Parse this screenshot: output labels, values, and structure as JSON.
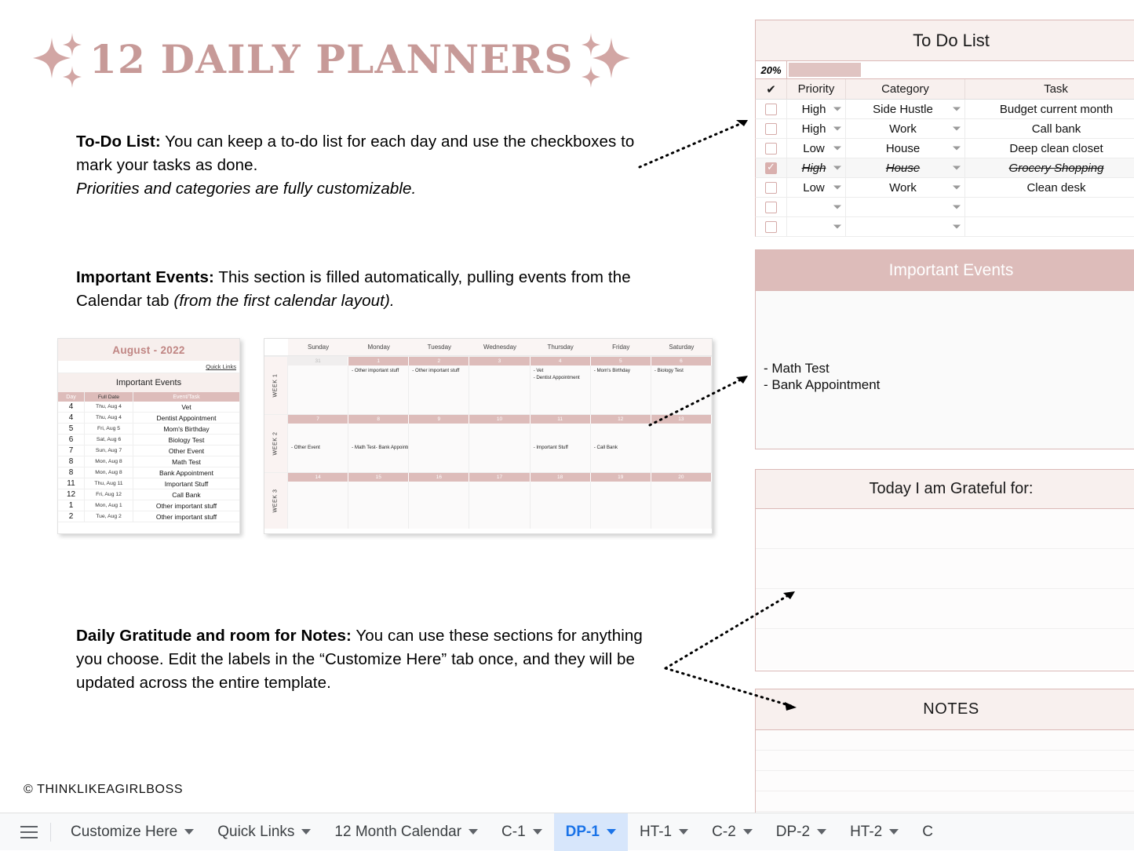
{
  "title": "12 DAILY PLANNERS",
  "paragraphs": {
    "todo": {
      "bold": "To-Do List:",
      "normal": " You can keep a to-do list for each day and use the checkboxes to mark your tasks as done.",
      "italic": "Priorities and categories are fully customizable."
    },
    "events": {
      "bold": "Important Events:",
      "normal": " This section is filled automatically, pulling events from the Calendar tab ",
      "italic": "(from the first calendar layout)."
    },
    "gratitude": {
      "bold": "Daily Gratitude and room for Notes:",
      "normal": " You can use these sections for anything you choose. Edit the labels in the “Customize Here” tab once, and they will be updated across the entire template."
    }
  },
  "mini_month": {
    "month_title": "August - 2022",
    "quick_links": "Quick Links",
    "section_title": "Important Events",
    "columns": [
      "Day",
      "Full Date",
      "Event/Task"
    ],
    "rows": [
      {
        "day": "4",
        "full_date": "Thu, Aug 4",
        "event": "Vet"
      },
      {
        "day": "4",
        "full_date": "Thu, Aug 4",
        "event": "Dentist Appointment"
      },
      {
        "day": "5",
        "full_date": "Fri, Aug 5",
        "event": "Mom's Birthday"
      },
      {
        "day": "6",
        "full_date": "Sat, Aug 6",
        "event": "Biology Test"
      },
      {
        "day": "7",
        "full_date": "Sun, Aug 7",
        "event": "Other Event"
      },
      {
        "day": "8",
        "full_date": "Mon, Aug 8",
        "event": "Math Test"
      },
      {
        "day": "8",
        "full_date": "Mon, Aug 8",
        "event": "Bank Appointment"
      },
      {
        "day": "11",
        "full_date": "Thu, Aug 11",
        "event": "Important Stuff"
      },
      {
        "day": "12",
        "full_date": "Fri, Aug 12",
        "event": "Call Bank"
      },
      {
        "day": "1",
        "full_date": "Mon, Aug 1",
        "event": "Other important stuff"
      },
      {
        "day": "2",
        "full_date": "Tue, Aug 2",
        "event": "Other important stuff"
      }
    ]
  },
  "calendar": {
    "days_of_week": [
      "Sunday",
      "Monday",
      "Tuesday",
      "Wednesday",
      "Thursday",
      "Friday",
      "Saturday"
    ],
    "weeks": [
      {
        "label": "WEEK 1",
        "numbers": [
          "31",
          "1",
          "2",
          "3",
          "4",
          "5",
          "6"
        ],
        "prev_month_flags": [
          true,
          false,
          false,
          false,
          false,
          false,
          false
        ],
        "cells": [
          "",
          "- Other important stuff",
          "- Other important stuff",
          "",
          "- Vet\n- Dentist Appointment",
          "- Mom's Birthday",
          "- Biology Test"
        ]
      },
      {
        "label": "WEEK 2",
        "numbers": [
          "7",
          "8",
          "9",
          "10",
          "11",
          "12",
          "13"
        ],
        "prev_month_flags": [
          false,
          false,
          false,
          false,
          false,
          false,
          false
        ],
        "cells": [
          "- Other Event",
          "- Math Test\n- Bank Appointment",
          "",
          "",
          "- Important Stuff",
          "- Call Bank",
          ""
        ]
      },
      {
        "label": "WEEK 3",
        "numbers": [
          "14",
          "15",
          "16",
          "17",
          "18",
          "19",
          "20"
        ],
        "prev_month_flags": [
          false,
          false,
          false,
          false,
          false,
          false,
          false
        ],
        "cells": [
          "",
          "",
          "",
          "",
          "",
          "",
          ""
        ]
      }
    ]
  },
  "todo_panel": {
    "title": "To Do List",
    "progress_percent": "20%",
    "progress_value": 20,
    "columns": {
      "check": "✔",
      "priority": "Priority",
      "category": "Category",
      "task": "Task"
    },
    "rows": [
      {
        "checked": false,
        "priority": "High",
        "category": "Side Hustle",
        "task": "Budget current month"
      },
      {
        "checked": false,
        "priority": "High",
        "category": "Work",
        "task": "Call bank"
      },
      {
        "checked": false,
        "priority": "Low",
        "category": "House",
        "task": "Deep clean closet"
      },
      {
        "checked": true,
        "priority": "High",
        "category": "House",
        "task": "Grocery Shopping"
      },
      {
        "checked": false,
        "priority": "Low",
        "category": "Work",
        "task": "Clean desk"
      },
      {
        "checked": false,
        "priority": "",
        "category": "",
        "task": ""
      },
      {
        "checked": false,
        "priority": "",
        "category": "",
        "task": ""
      }
    ]
  },
  "important_events_panel": {
    "title": "Important Events",
    "items": [
      "- Math Test",
      "- Bank Appointment"
    ]
  },
  "gratitude_panel": {
    "title": "Today I am Grateful for:",
    "line_count": 4
  },
  "notes_panel": {
    "title": "NOTES",
    "line_count": 4
  },
  "credit": "© THINKLIKEAGIRLBOSS",
  "tabbar": {
    "menu_icon": "hamburger-menu-icon",
    "tabs": [
      {
        "label": "Customize Here",
        "active": false
      },
      {
        "label": "Quick Links",
        "active": false
      },
      {
        "label": "12 Month Calendar",
        "active": false
      },
      {
        "label": "C-1",
        "active": false
      },
      {
        "label": "DP-1",
        "active": true
      },
      {
        "label": "HT-1",
        "active": false
      },
      {
        "label": "C-2",
        "active": false
      },
      {
        "label": "DP-2",
        "active": false
      },
      {
        "label": "HT-2",
        "active": false
      },
      {
        "label": "C",
        "active": false
      }
    ]
  },
  "colors": {
    "brand_rose": "#c79a98",
    "header_rose": "#ddbcba",
    "soft_blush": "#f8f0ee",
    "border_rose": "#dbb9b7",
    "tab_active_text": "#1a73e8",
    "tab_active_bg": "#d7e6fb"
  }
}
